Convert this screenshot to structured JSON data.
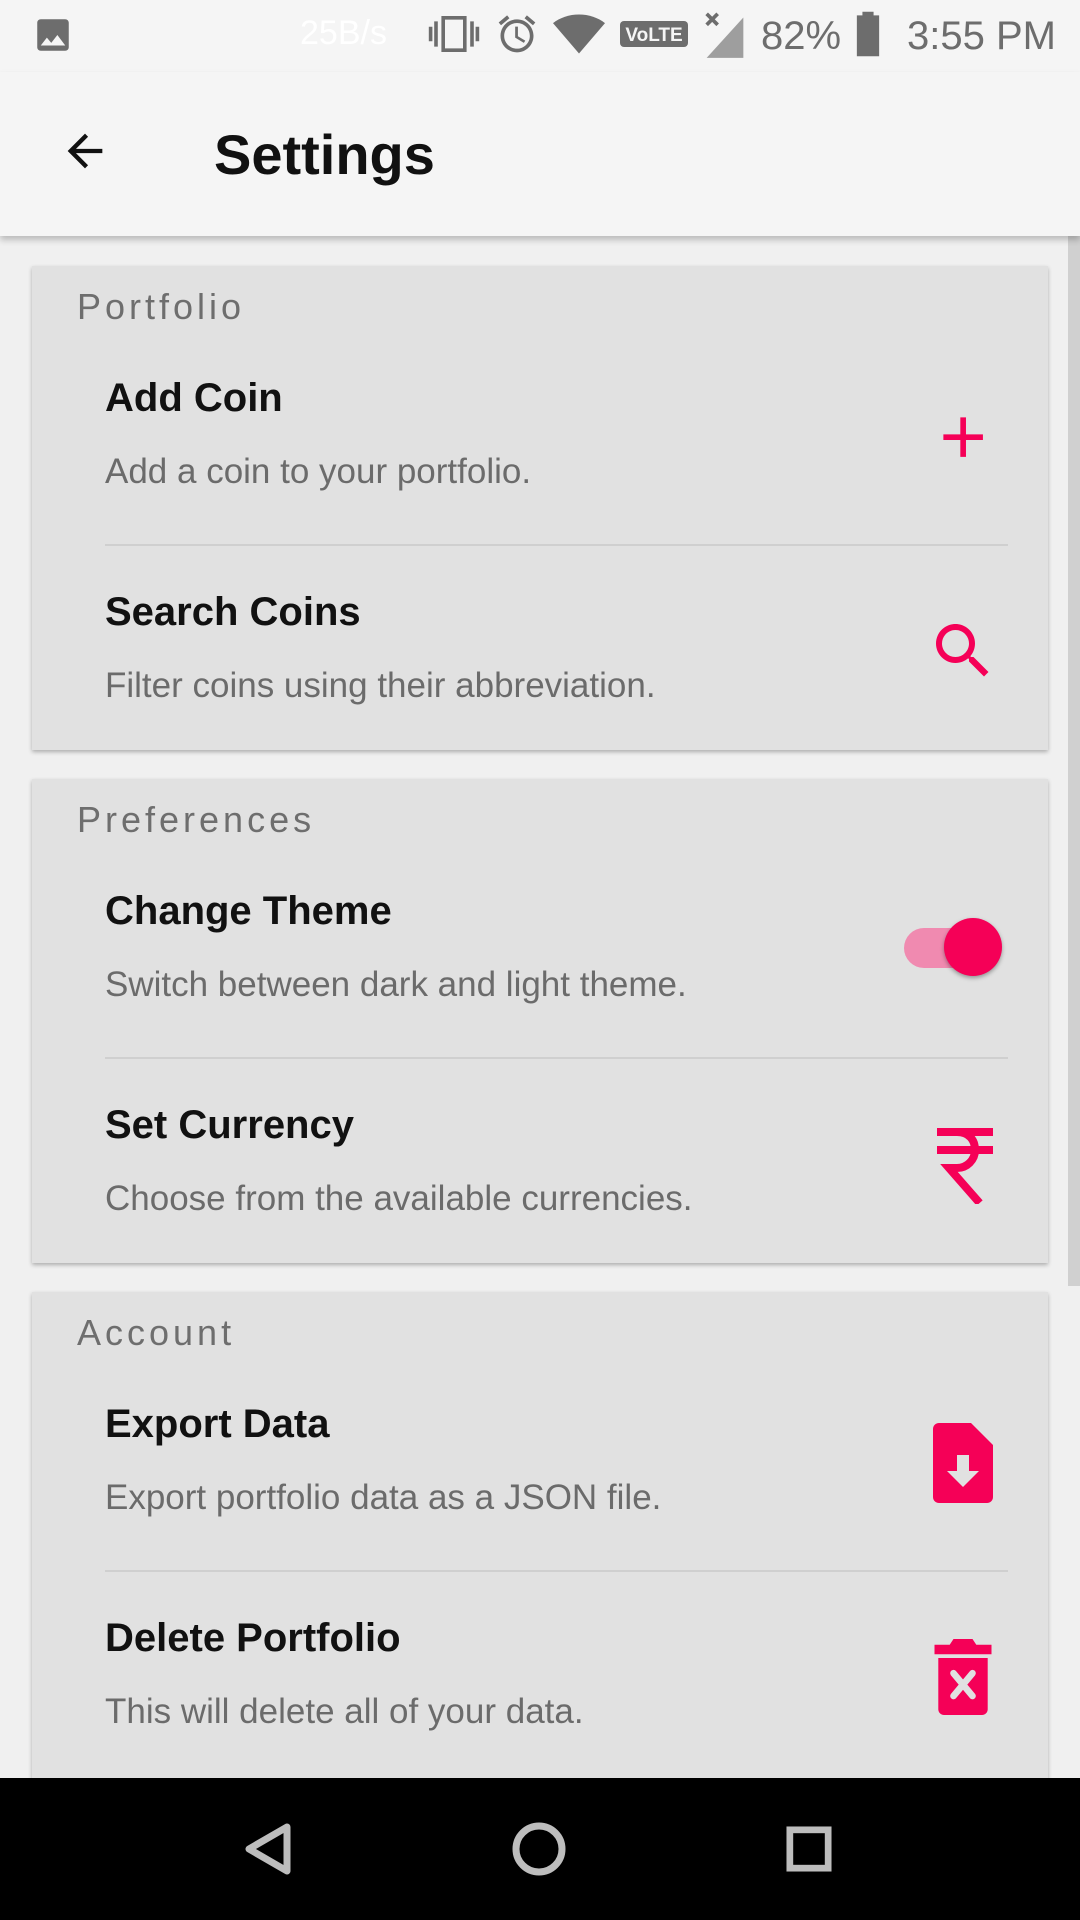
{
  "status_bar": {
    "net_speed": "25B/s",
    "battery_percent": "82%",
    "time": "3:55 PM",
    "icons": [
      "image-icon",
      "vibrate-icon",
      "alarm-icon",
      "wifi-icon",
      "volte-icon",
      "signal-icon",
      "battery-icon"
    ]
  },
  "app_bar": {
    "title": "Settings",
    "back_icon": "arrow-back-icon"
  },
  "accent_color": "#f50057",
  "sections": [
    {
      "header": "Portfolio",
      "items": [
        {
          "title": "Add Coin",
          "description": "Add a coin to your portfolio.",
          "icon": "plus-icon"
        },
        {
          "title": "Search Coins",
          "description": "Filter coins using their abbreviation.",
          "icon": "search-icon"
        }
      ]
    },
    {
      "header": "Preferences",
      "items": [
        {
          "title": "Change Theme",
          "description": "Switch between dark and light theme.",
          "icon": "toggle-switch",
          "toggle_on": true
        },
        {
          "title": "Set Currency",
          "description": "Choose from the available currencies.",
          "icon": "rupee-icon"
        }
      ]
    },
    {
      "header": "Account",
      "items": [
        {
          "title": "Export Data",
          "description": "Export portfolio data as a JSON file.",
          "icon": "file-download-icon"
        },
        {
          "title": "Delete Portfolio",
          "description": "This will delete all of your data.",
          "icon": "delete-icon"
        }
      ]
    }
  ],
  "nav_bar": {
    "icons": [
      "back-triangle-icon",
      "home-circle-icon",
      "recents-square-icon"
    ]
  }
}
